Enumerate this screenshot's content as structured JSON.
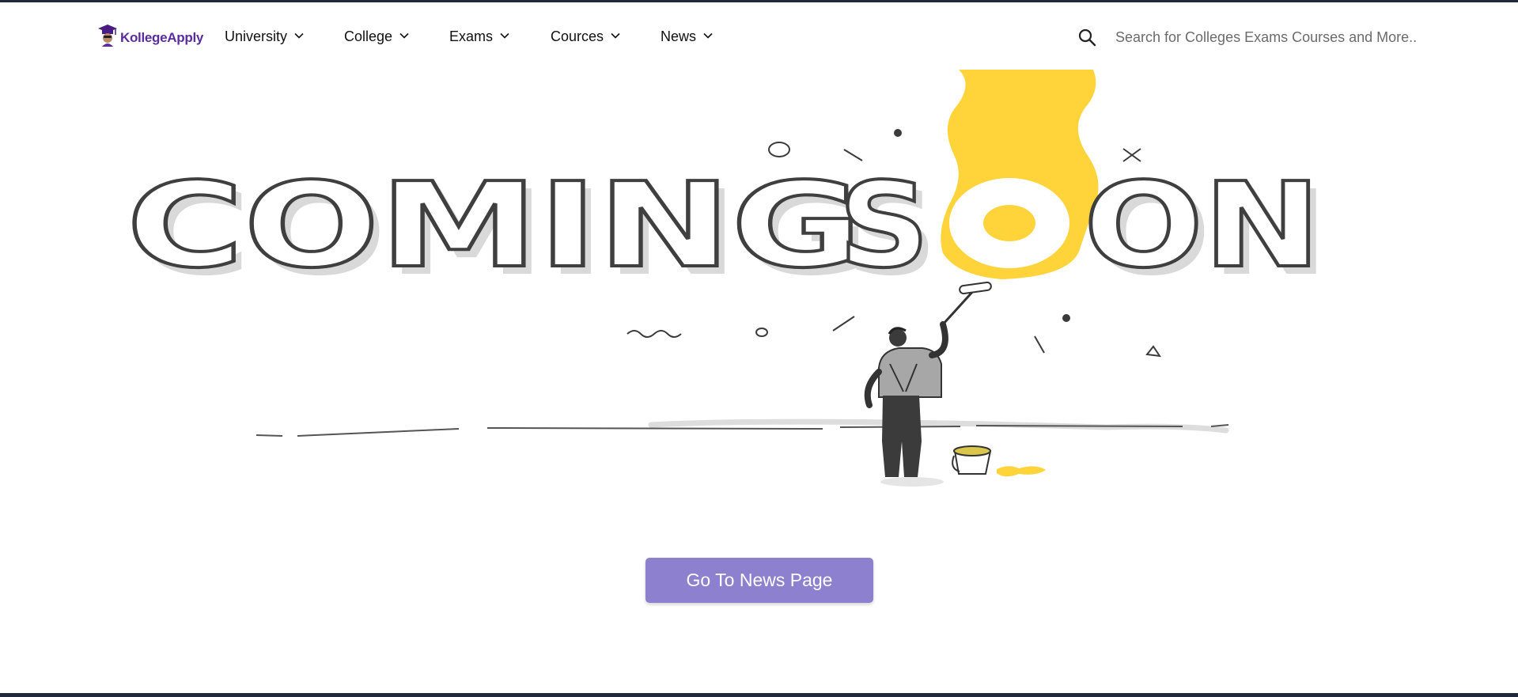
{
  "brand": {
    "name": "KollegeApply",
    "color": "#5a2ca0"
  },
  "nav": {
    "items": [
      {
        "label": "University"
      },
      {
        "label": "College"
      },
      {
        "label": "Exams"
      },
      {
        "label": "Cources"
      },
      {
        "label": "News"
      }
    ]
  },
  "search": {
    "placeholder": "Search for Colleges Exams Courses and More.."
  },
  "hero": {
    "headline": "COMING SOON",
    "paint_color": "#ffd43b"
  },
  "cta": {
    "label": "Go To News Page",
    "color": "#8d80cf"
  }
}
